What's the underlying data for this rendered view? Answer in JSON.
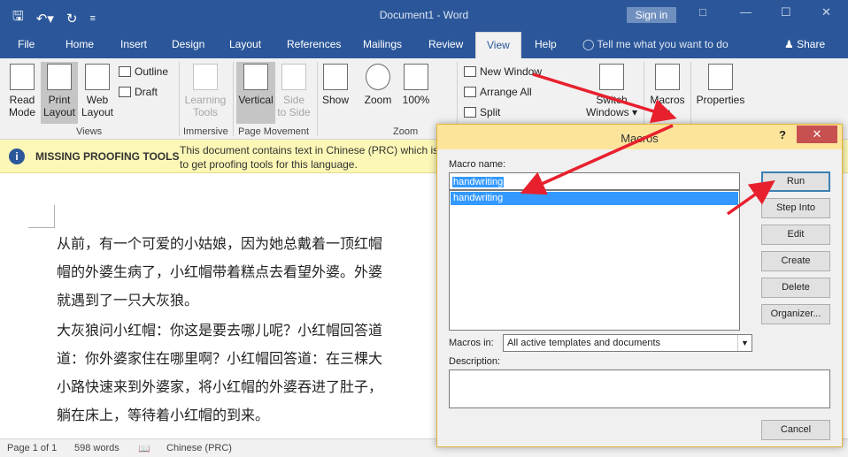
{
  "titlebar": {
    "doc_title": "Document1 - Word",
    "signin": "Sign in",
    "qat_icons": [
      "save-icon",
      "undo-icon",
      "redo-icon",
      "customize-icon"
    ],
    "controls": [
      "restore-ribbon-icon",
      "minimize-icon",
      "maximize-icon",
      "close-icon"
    ]
  },
  "tabs": [
    "File",
    "Home",
    "Insert",
    "Design",
    "Layout",
    "References",
    "Mailings",
    "Review",
    "View",
    "Help"
  ],
  "active_tab": "View",
  "tell_me": "Tell me what you want to do",
  "share": "Share",
  "ribbon": {
    "read_mode": [
      "Read",
      "Mode"
    ],
    "print_layout": [
      "Print",
      "Layout"
    ],
    "web_layout": [
      "Web",
      "Layout"
    ],
    "outline": "Outline",
    "draft": "Draft",
    "views_group": "Views",
    "learning_tools": [
      "Learning",
      "Tools"
    ],
    "immersive_group": "Immersive",
    "vertical": "Vertical",
    "side_to_side": [
      "Side",
      "to Side"
    ],
    "page_movement_group": "Page Movement",
    "show": "Show",
    "zoom": "Zoom",
    "zoom_100": "100%",
    "zoom_group": "Zoom",
    "new_window": "New Window",
    "arrange_all": "Arrange All",
    "split": "Split",
    "switch_windows": [
      "Switch",
      "Windows"
    ],
    "macros": "Macros",
    "properties": "Properties"
  },
  "infobar": {
    "title": "MISSING PROOFING TOOLS",
    "message_line1": "This document contains text in Chinese (PRC) which is",
    "message_line2": "to get proofing tools for this language."
  },
  "document": {
    "lines": [
      "从前，有一个可爱的小姑娘，因为她总戴着一顶红帽",
      "帽的外婆生病了，小红帽带着糕点去看望外婆。外婆",
      "就遇到了一只大灰狼。",
      "大灰狼问小红帽：你这是要去哪儿呢？小红帽回答道",
      "道：你外婆家住在哪里啊？小红帽回答道：在三棵大",
      "小路快速来到外婆家，将小红帽的外婆吞进了肚子，",
      "躺在床上，等待着小红帽的到来。"
    ]
  },
  "statusbar": {
    "page": "Page 1 of 1",
    "words": "598 words",
    "language": "Chinese (PRC)"
  },
  "dialog": {
    "title": "Macros",
    "help": "?",
    "close": "✕",
    "macro_name_label": "Macro name:",
    "macro_name_value": "handwriting",
    "macros_list": [
      "handwriting"
    ],
    "buttons": {
      "run": "Run",
      "step_into": "Step Into",
      "edit": "Edit",
      "create": "Create",
      "delete": "Delete",
      "organizer": "Organizer..."
    },
    "macros_in_label": "Macros in:",
    "macros_in_value": "All active templates and documents",
    "description_label": "Description:",
    "cancel": "Cancel"
  },
  "colors": {
    "word_blue": "#2b579a",
    "dialog_title_bg": "#fce49b",
    "annotation_arrow": "#e8202e",
    "selection_blue": "#3399ff",
    "infobar_bg": "#fcf7b6"
  }
}
